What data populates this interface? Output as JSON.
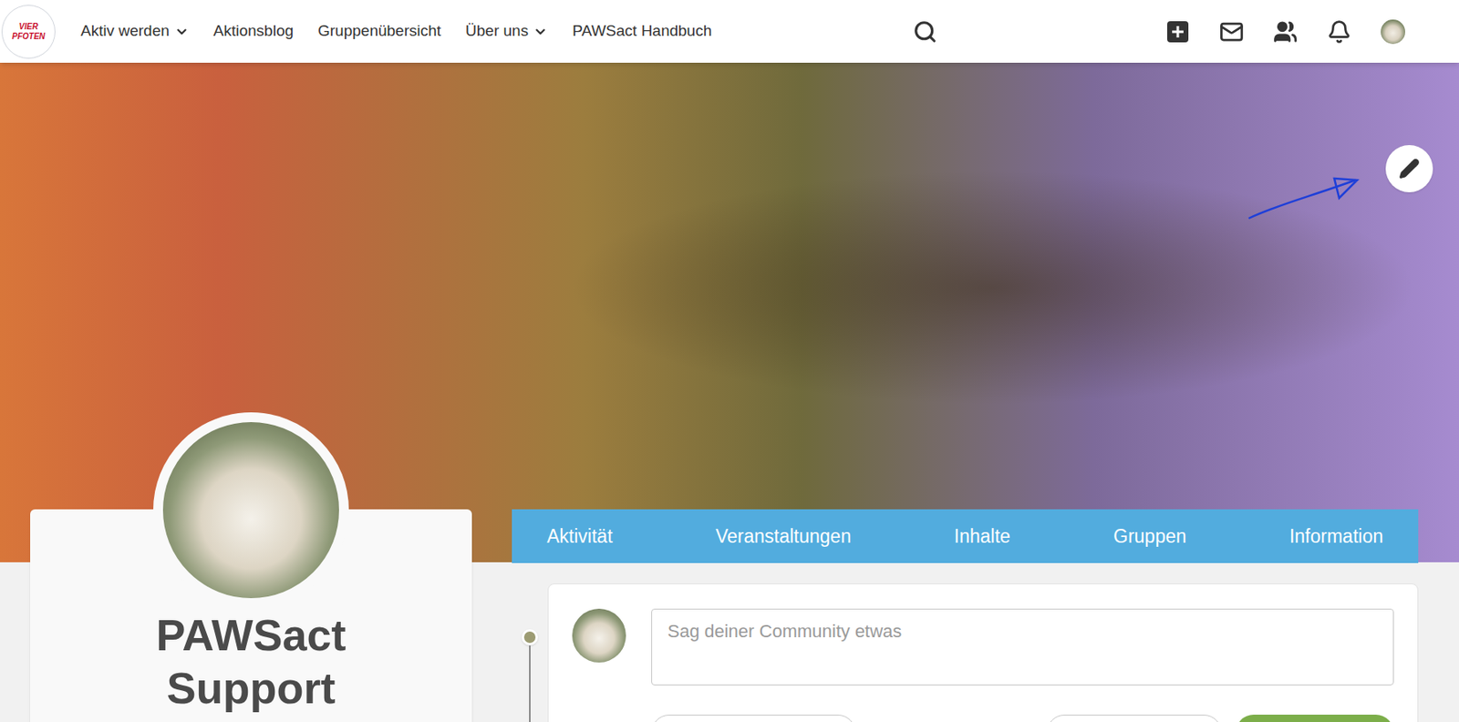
{
  "logo": {
    "text": "VIER PFOTEN"
  },
  "nav": {
    "items": [
      {
        "label": "Aktiv werden",
        "dropdown": true
      },
      {
        "label": "Aktionsblog",
        "dropdown": false
      },
      {
        "label": "Gruppenübersicht",
        "dropdown": false
      },
      {
        "label": "Über uns",
        "dropdown": true
      },
      {
        "label": "PAWSact Handbuch",
        "dropdown": false
      }
    ]
  },
  "profile": {
    "name": "PAWSact Support"
  },
  "tabs": [
    {
      "label": "Aktivität",
      "selected": false
    },
    {
      "label": "Veranstaltungen",
      "selected": false
    },
    {
      "label": "Inhalte",
      "selected": false
    },
    {
      "label": "Gruppen",
      "selected": false
    },
    {
      "label": "Information",
      "selected": false
    }
  ],
  "composer": {
    "placeholder": "Sag deiner Community etwas"
  }
}
